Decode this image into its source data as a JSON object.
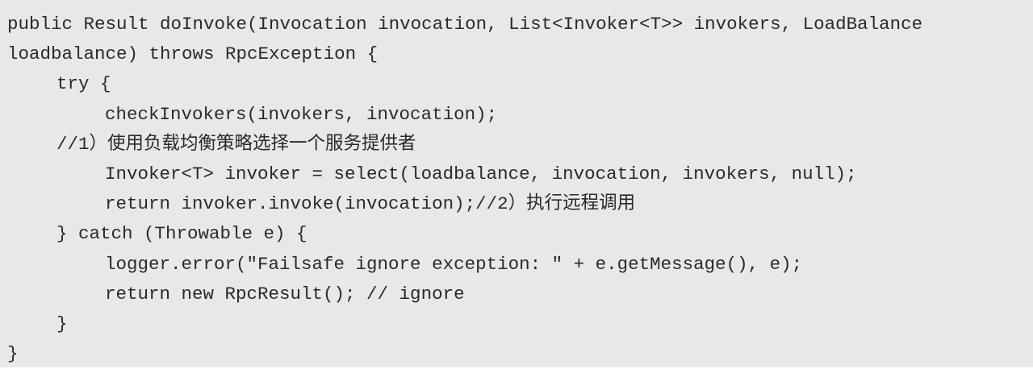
{
  "code": {
    "lines": [
      "public Result doInvoke(Invocation invocation, List<Invoker<T>> invokers, LoadBalance",
      "loadbalance) throws RpcException {",
      "try {",
      "checkInvokers(invokers, invocation);",
      "//1）使用负载均衡策略选择一个服务提供者",
      "Invoker<T> invoker = select(loadbalance, invocation, invokers, null);",
      "return invoker.invoke(invocation);//2）执行远程调用",
      "} catch (Throwable e) {",
      "logger.error(\"Failsafe ignore exception: \" + e.getMessage(), e);",
      "return new RpcResult(); // ignore",
      "}",
      "}"
    ]
  }
}
